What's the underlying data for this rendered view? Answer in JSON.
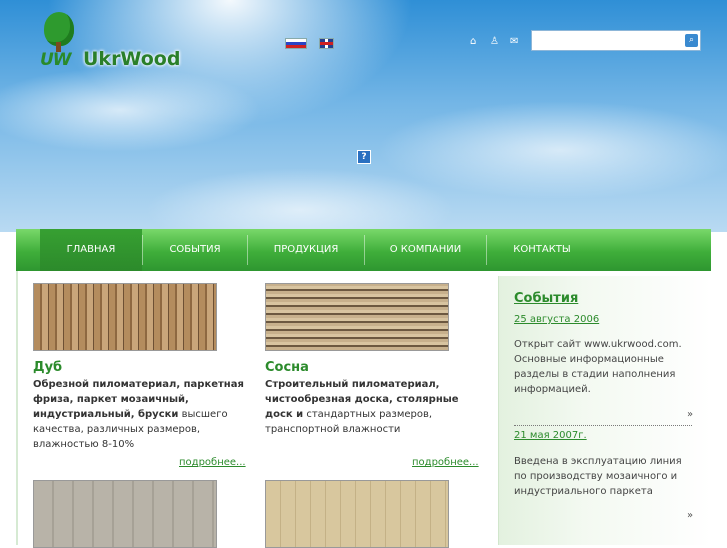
{
  "brand": {
    "logo_letters": "UW",
    "name": "UkrWood"
  },
  "header": {
    "languages": [
      {
        "name": "ru-flag-icon"
      },
      {
        "name": "en-flag-icon"
      }
    ],
    "top_icons": [
      "home-icon",
      "sitemap-icon",
      "mail-icon"
    ],
    "search": {
      "value": "",
      "placeholder": ""
    },
    "banner_placeholder": "?"
  },
  "nav": {
    "items": [
      {
        "label": "ГЛАВНАЯ",
        "active": true
      },
      {
        "label": "СОБЫТИЯ"
      },
      {
        "label": "ПРОДУКЦИЯ"
      },
      {
        "label": "О КОМПАНИИ"
      },
      {
        "label": "КОНТАКТЫ"
      }
    ]
  },
  "products": [
    {
      "title": "Дуб",
      "bold": "Обрезной пиломатериал, паркетная фриза, паркет мозаичный, индустриальный, бруски",
      "text": " высшего качества, различных размеров, влажностью 8-10%",
      "more": "подробнее..."
    },
    {
      "title": "Сосна",
      "bold": "Строительный пиломатериал, чистообрезная доска, столярные доск и",
      "text": " стандартных размеров, транспортной влажности",
      "more": "подробнее..."
    }
  ],
  "sidebar": {
    "title": "События",
    "news": [
      {
        "date": "25 августа 2006",
        "text": "Открыт сайт     www.ukrwood.com. Основные информационные разделы в стадии наполнения информацией.",
        "more": "»"
      },
      {
        "date": "21 мая 2007г.",
        "text": "Введена в эксплуатацию линия по производству мозаичного и индустриального паркета",
        "more": "»"
      }
    ]
  },
  "colors": {
    "accent_green": "#2c8b2c",
    "nav_green": "#3fae3a",
    "sky_blue": "#2f8fd6"
  }
}
